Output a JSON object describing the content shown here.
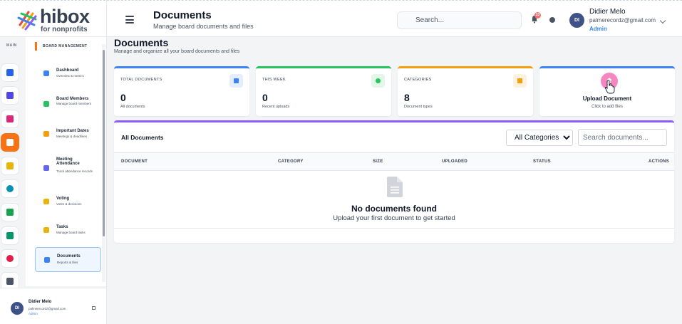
{
  "brand": {
    "name": "hibox",
    "tagline": "for nonprofits"
  },
  "header": {
    "title": "Documents",
    "subtitle": "Manage board documents and files",
    "search_placeholder": "Search...",
    "notification_count": "13",
    "user": {
      "initials": "DI",
      "name": "Didier Melo",
      "email": "palmerecordz@gmail.com",
      "role": "Admin"
    }
  },
  "sidebar": {
    "main_label": "MAIN",
    "rail": [
      {
        "icon": "home-icon",
        "color": "#2563eb"
      },
      {
        "icon": "org-chart-icon",
        "color": "#4f46e5"
      },
      {
        "icon": "handshake-icon",
        "color": "#db2777"
      },
      {
        "icon": "documents-icon",
        "color": "#ffffff",
        "bg": "#f97316",
        "active": true
      },
      {
        "icon": "graduation-cap-icon",
        "color": "#eab308"
      },
      {
        "icon": "globe-icon",
        "color": "#0891b2"
      },
      {
        "icon": "network-icon",
        "color": "#16a34a"
      },
      {
        "icon": "people-icon",
        "color": "#059669"
      },
      {
        "icon": "pie-chart-icon",
        "color": "#e11d48"
      },
      {
        "icon": "settings-icon",
        "color": "#4b5563"
      }
    ],
    "section_label": "BOARD MANAGEMENT",
    "items": [
      {
        "label": "Dashboard",
        "desc": "Overview & metrics",
        "icon": "dashboard-icon",
        "color": "#3b82f6"
      },
      {
        "label": "Board Members",
        "desc": "Manage board members",
        "icon": "members-icon",
        "color": "#22c55e"
      },
      {
        "label": "Important Dates",
        "desc": "Meetings & deadlines",
        "icon": "calendar-icon",
        "color": "#f59e0b"
      },
      {
        "label": "Meeting Attendance",
        "desc": "Track attendance records",
        "icon": "attendance-icon",
        "color": "#6366f1"
      },
      {
        "label": "Voting",
        "desc": "Votes & decisions",
        "icon": "voting-icon",
        "color": "#eab308"
      },
      {
        "label": "Tasks",
        "desc": "Manage board tasks",
        "icon": "tasks-icon",
        "color": "#eab308"
      },
      {
        "label": "Documents",
        "desc": "Reports & files",
        "icon": "document-icon",
        "color": "#3b82f6",
        "active": true
      }
    ],
    "footer_user": {
      "initials": "DI",
      "name": "Didier Melo",
      "email": "palmerecordz@gmail.com",
      "role": "Admin"
    }
  },
  "page": {
    "title": "Documents",
    "subtitle": "Manage and organize all your board documents and files"
  },
  "stats": [
    {
      "label": "TOTAL DOCUMENTS",
      "value": "0",
      "desc": "All documents",
      "accent": "#3b82f6",
      "icon": "document-icon"
    },
    {
      "label": "THIS WEEK",
      "value": "0",
      "desc": "Recent uploads",
      "accent": "#22c55e",
      "icon": "clock-icon"
    },
    {
      "label": "CATEGORIES",
      "value": "8",
      "desc": "Document types",
      "accent": "#f59e0b",
      "icon": "folder-icon"
    }
  ],
  "upload": {
    "title": "Upload Document",
    "subtitle": "Click to add files",
    "icon": "upload-icon"
  },
  "table": {
    "title": "All Documents",
    "filter_value": "All Categories",
    "search_placeholder": "Search documents...",
    "columns": [
      "DOCUMENT",
      "CATEGORY",
      "SIZE",
      "UPLOADED",
      "STATUS",
      "ACTIONS"
    ],
    "empty_title": "No documents found",
    "empty_subtitle": "Upload your first document to get started"
  }
}
